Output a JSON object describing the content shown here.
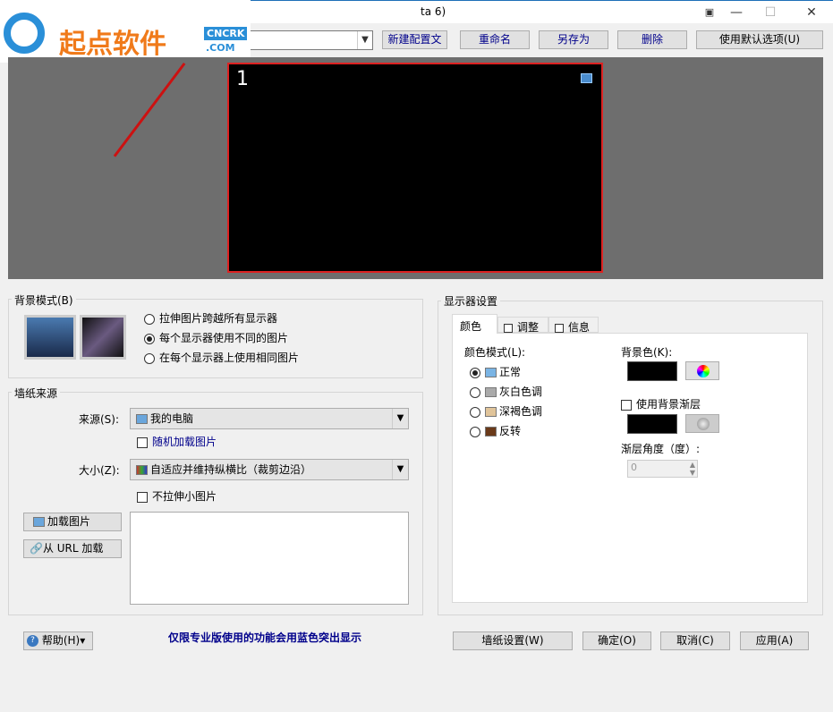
{
  "window": {
    "title_fragment": "ta 6)",
    "minimize": "—",
    "maximize": "☐",
    "close": "✕",
    "restore_icon": "window-pin"
  },
  "watermark": {
    "text": "起点软件",
    "badge_top": "CNCRK",
    "badge_bottom": ".COM"
  },
  "toolbar": {
    "profile_value": "",
    "buttons": [
      "新建配置文",
      "重命名",
      "另存为",
      "删除",
      "使用默认选项(U)"
    ]
  },
  "preview": {
    "monitor_number": "1"
  },
  "background_mode": {
    "title": "背景模式(B)",
    "options": [
      "拉伸图片跨越所有显示器",
      "每个显示器使用不同的图片",
      "在每个显示器上使用相同图片"
    ],
    "selected": 1
  },
  "wallpaper_source": {
    "title": "墙纸来源",
    "source_label": "来源(S):",
    "source_value": "我的电脑",
    "random_label": "随机加载图片",
    "size_label": "大小(Z):",
    "size_value": "自适应并维持纵横比（裁剪边沿）",
    "no_stretch_label": "不拉伸小图片",
    "load_image": "加载图片",
    "load_url": "从 URL 加载"
  },
  "monitor_settings": {
    "title": "显示器设置",
    "tabs": [
      "颜色",
      "调整",
      "信息"
    ],
    "color_mode_label": "颜色模式(L):",
    "color_modes": [
      "正常",
      "灰白色调",
      "深褐色调",
      "反转"
    ],
    "selected_mode": 0,
    "bg_color_label": "背景色(K):",
    "gradient_label": "使用背景渐层",
    "gradient_angle_label": "渐层角度（度）:",
    "gradient_angle_value": "0"
  },
  "footer": {
    "help": "帮助(H)",
    "pro_note": "仅限专业版使用的功能会用蓝色突出显示",
    "wallpaper_settings": "墙纸设置(W)",
    "ok": "确定(O)",
    "cancel": "取消(C)",
    "apply": "应用(A)"
  }
}
